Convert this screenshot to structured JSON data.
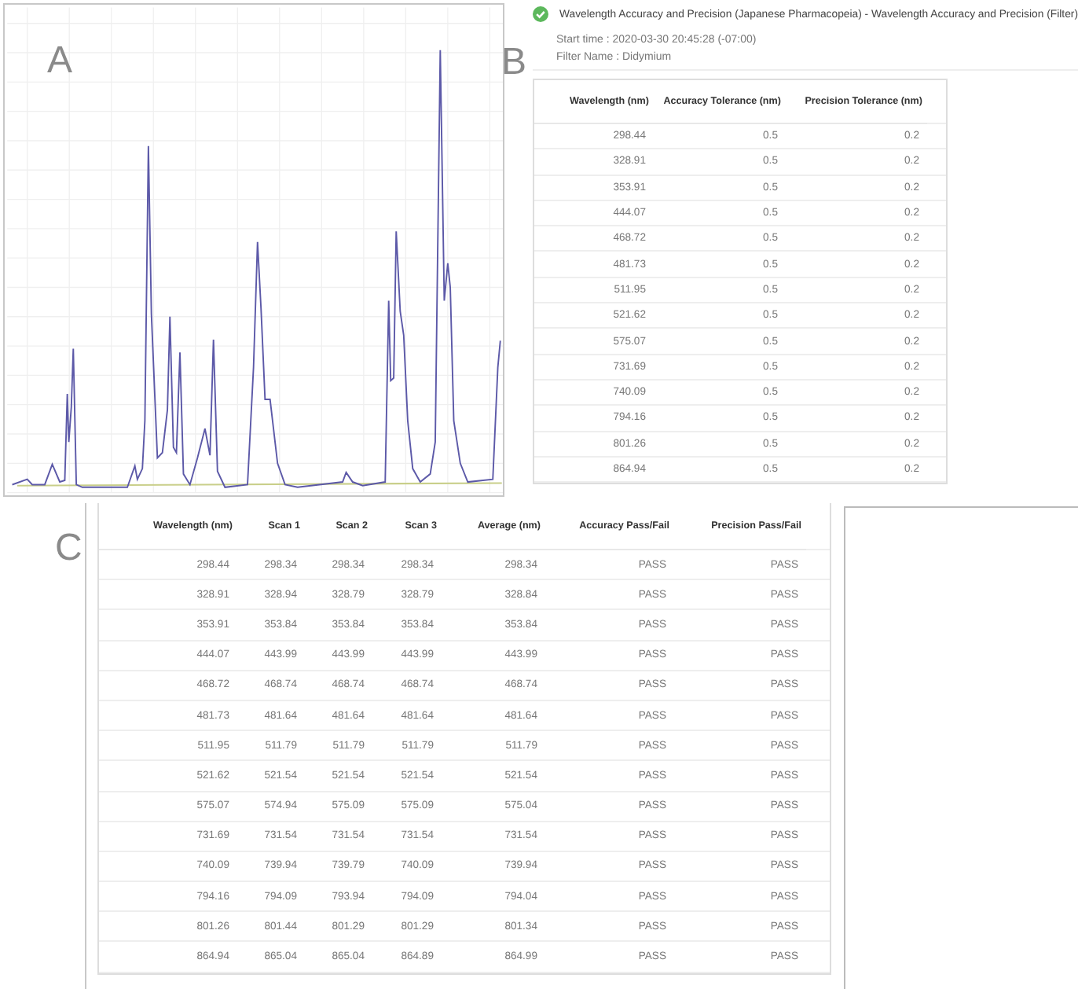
{
  "panel_a": {
    "label": "A"
  },
  "panel_b": {
    "label": "B",
    "passed": true,
    "title": "Wavelength Accuracy and Precision (Japanese Pharmacopeia) - Wavelength Accuracy and Precision (Filter)",
    "details": [
      "Start time : 2020-03-30 20:45:28 (-07:00)",
      "Filter Name : Didymium"
    ],
    "table": {
      "columns": [
        "Wavelength (nm)",
        "Accuracy Tolerance (nm)",
        "Precision Tolerance (nm)"
      ],
      "rows": [
        [
          "298.44",
          "0.5",
          "0.2"
        ],
        [
          "328.91",
          "0.5",
          "0.2"
        ],
        [
          "353.91",
          "0.5",
          "0.2"
        ],
        [
          "444.07",
          "0.5",
          "0.2"
        ],
        [
          "468.72",
          "0.5",
          "0.2"
        ],
        [
          "481.73",
          "0.5",
          "0.2"
        ],
        [
          "511.95",
          "0.5",
          "0.2"
        ],
        [
          "521.62",
          "0.5",
          "0.2"
        ],
        [
          "575.07",
          "0.5",
          "0.2"
        ],
        [
          "731.69",
          "0.5",
          "0.2"
        ],
        [
          "740.09",
          "0.5",
          "0.2"
        ],
        [
          "794.16",
          "0.5",
          "0.2"
        ],
        [
          "801.26",
          "0.5",
          "0.2"
        ],
        [
          "864.94",
          "0.5",
          "0.2"
        ]
      ]
    }
  },
  "panel_c": {
    "label": "C",
    "table": {
      "columns": [
        "Wavelength (nm)",
        "Scan 1",
        "Scan 2",
        "Scan 3",
        "Average (nm)",
        "Accuracy Pass/Fail",
        "Precision Pass/Fail"
      ],
      "rows": [
        [
          "298.44",
          "298.34",
          "298.34",
          "298.34",
          "298.34",
          "PASS",
          "PASS"
        ],
        [
          "328.91",
          "328.94",
          "328.79",
          "328.79",
          "328.84",
          "PASS",
          "PASS"
        ],
        [
          "353.91",
          "353.84",
          "353.84",
          "353.84",
          "353.84",
          "PASS",
          "PASS"
        ],
        [
          "444.07",
          "443.99",
          "443.99",
          "443.99",
          "443.99",
          "PASS",
          "PASS"
        ],
        [
          "468.72",
          "468.74",
          "468.74",
          "468.74",
          "468.74",
          "PASS",
          "PASS"
        ],
        [
          "481.73",
          "481.64",
          "481.64",
          "481.64",
          "481.64",
          "PASS",
          "PASS"
        ],
        [
          "511.95",
          "511.79",
          "511.79",
          "511.79",
          "511.79",
          "PASS",
          "PASS"
        ],
        [
          "521.62",
          "521.54",
          "521.54",
          "521.54",
          "521.54",
          "PASS",
          "PASS"
        ],
        [
          "575.07",
          "574.94",
          "575.09",
          "575.09",
          "575.04",
          "PASS",
          "PASS"
        ],
        [
          "731.69",
          "731.54",
          "731.54",
          "731.54",
          "731.54",
          "PASS",
          "PASS"
        ],
        [
          "740.09",
          "739.94",
          "739.79",
          "740.09",
          "739.94",
          "PASS",
          "PASS"
        ],
        [
          "794.16",
          "794.09",
          "793.94",
          "794.09",
          "794.04",
          "PASS",
          "PASS"
        ],
        [
          "801.26",
          "801.44",
          "801.29",
          "801.29",
          "801.34",
          "PASS",
          "PASS"
        ],
        [
          "864.94",
          "865.04",
          "865.04",
          "864.89",
          "864.99",
          "PASS",
          "PASS"
        ]
      ]
    }
  }
}
